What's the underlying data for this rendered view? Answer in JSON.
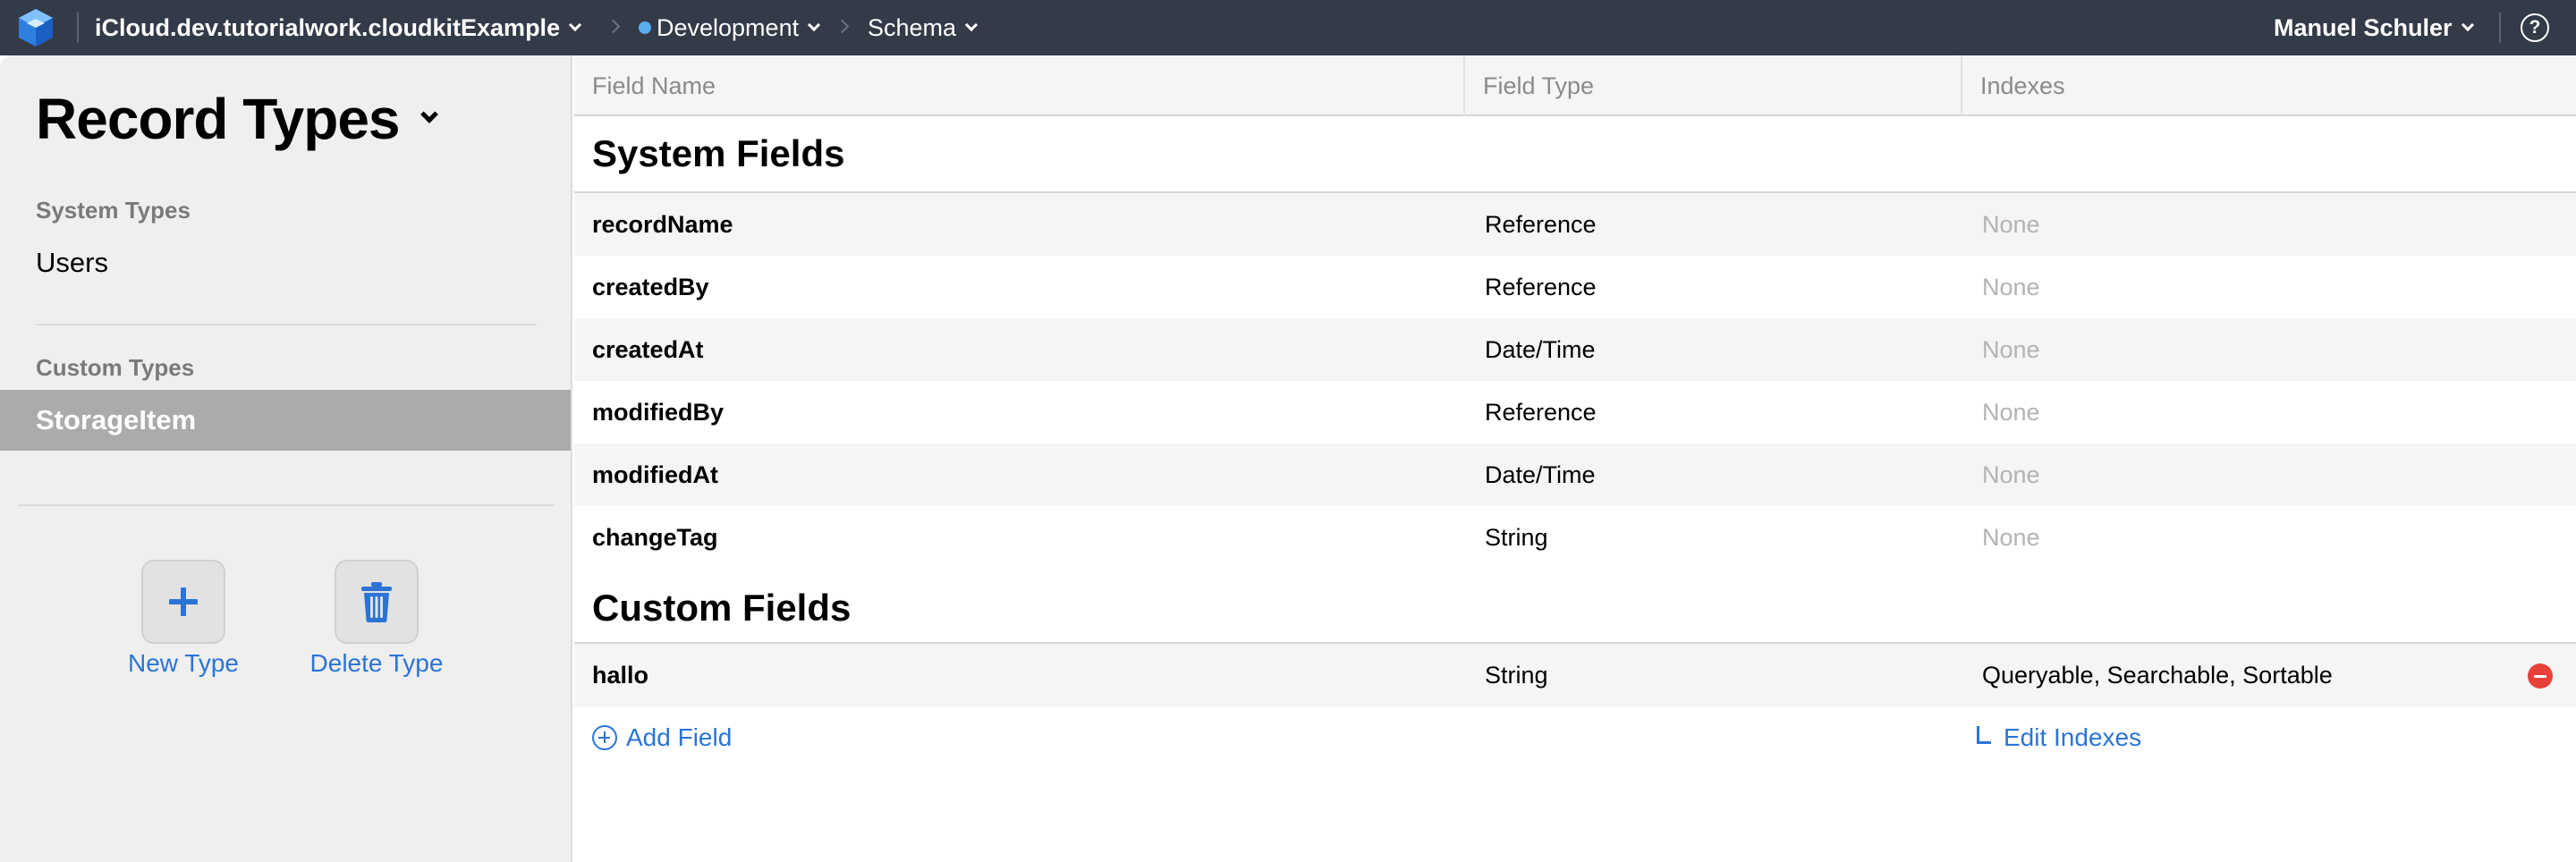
{
  "topbar": {
    "container": "iCloud.dev.tutorialwork.cloudkitExample",
    "environment": "Development",
    "environment_dot_color": "#5aaef0",
    "section": "Schema",
    "user": "Manuel Schuler",
    "help": "?"
  },
  "sidebar": {
    "title": "Record Types",
    "system_section_label": "System Types",
    "system_items": [
      "Users"
    ],
    "custom_section_label": "Custom Types",
    "custom_items": [
      "StorageItem"
    ],
    "selected_item": "StorageItem",
    "new_type_label": "New Type",
    "delete_type_label": "Delete Type",
    "accent_color": "#2b74d6"
  },
  "table": {
    "columns": [
      "Field Name",
      "Field Type",
      "Indexes"
    ],
    "system_group_title": "System Fields",
    "system_fields": [
      {
        "name": "recordName",
        "type": "Reference",
        "indexes": "None"
      },
      {
        "name": "createdBy",
        "type": "Reference",
        "indexes": "None"
      },
      {
        "name": "createdAt",
        "type": "Date/Time",
        "indexes": "None"
      },
      {
        "name": "modifiedBy",
        "type": "Reference",
        "indexes": "None"
      },
      {
        "name": "modifiedAt",
        "type": "Date/Time",
        "indexes": "None"
      },
      {
        "name": "changeTag",
        "type": "String",
        "indexes": "None"
      }
    ],
    "custom_group_title": "Custom Fields",
    "custom_fields": [
      {
        "name": "hallo",
        "type": "String",
        "indexes": "Queryable, Searchable, Sortable"
      }
    ],
    "add_field_label": "Add Field",
    "edit_indexes_label": "Edit Indexes",
    "remove_icon_color": "#e8403a"
  }
}
